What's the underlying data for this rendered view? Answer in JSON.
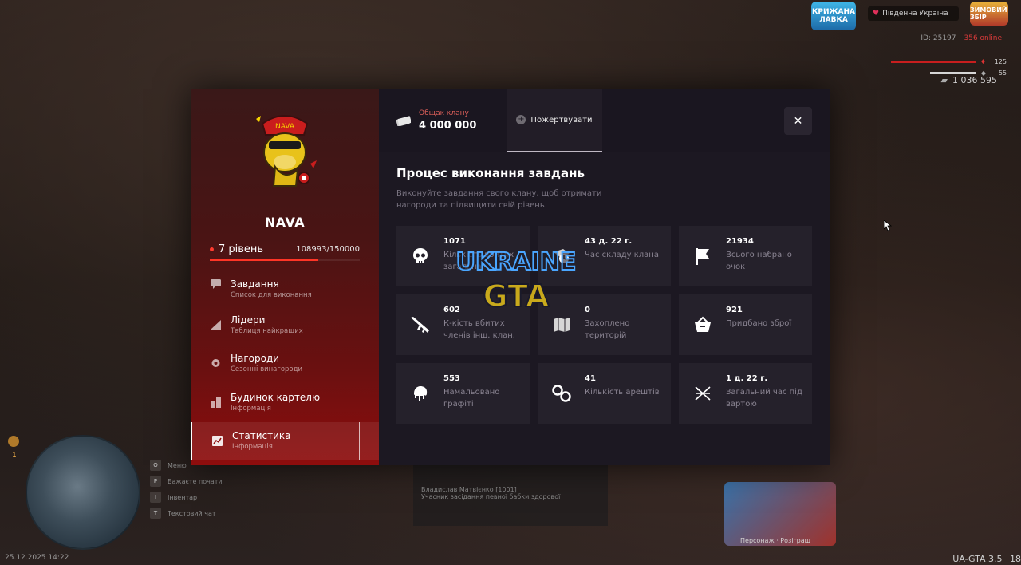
{
  "hud": {
    "logo_text": "КРИЖАНА ЛАВКА",
    "logo2_text": "ЗИМОВИЙ ЗБІР",
    "region": "Південна Україна",
    "player_id": "ID: 25197",
    "online": "356 online",
    "health": "125",
    "armor": "55",
    "money": "1 036 595",
    "datetime": "25.12.2025 14:22",
    "version": "UA-GTA 3.5",
    "fps": "18",
    "minimap_number": "1",
    "hints": [
      {
        "key": "O",
        "label": "Меню"
      },
      {
        "key": "P",
        "label": "Бажаєте почати"
      },
      {
        "key": "I",
        "label": "Інвентар"
      },
      {
        "key": "T",
        "label": "Текстовий чат"
      }
    ],
    "bg_panel": {
      "name": "Владислав Матвієнко [1001]",
      "desc": "Учасник засідання певної бабки здорової"
    },
    "promo_footer": "Персонаж · Розіграш"
  },
  "clan": {
    "name": "NAVA",
    "level_label": "7 рівень",
    "xp_text": "108993/150000",
    "xp_fraction": 0.726
  },
  "menu": [
    {
      "title": "Завдання",
      "subtitle": "Список для виконання"
    },
    {
      "title": "Лідери",
      "subtitle": "Таблиця найкращих"
    },
    {
      "title": "Нагороди",
      "subtitle": "Сезонні винагороди"
    },
    {
      "title": "Будинок картелю",
      "subtitle": "Інформація"
    },
    {
      "title": "Статистика",
      "subtitle": "Інформація"
    }
  ],
  "topbar": {
    "balance_label": "Общак клану",
    "balance_amount": "4 000 000",
    "donate_label": "Пожертвувати",
    "close_symbol": "✕"
  },
  "section": {
    "title": "Процес виконання завдань",
    "description": "Виконуйте завдання свого клану, щоб отримати нагороди та підвищити свій рівень"
  },
  "stats": [
    {
      "value": "1071",
      "label": "Кількість вбитих загальна",
      "icon": "skull-icon"
    },
    {
      "value": "43 д. 22 г.",
      "label": "Час складу клана",
      "icon": "clock-icon"
    },
    {
      "value": "21934",
      "label": "Всього набрано очок",
      "icon": "flag-icon"
    },
    {
      "value": "602",
      "label": "К-кість вбитих членів інш. клан.",
      "icon": "rifle-icon"
    },
    {
      "value": "0",
      "label": "Захоплено територій",
      "icon": "map-icon"
    },
    {
      "value": "921",
      "label": "Придбано зброї",
      "icon": "basket-icon"
    },
    {
      "value": "553",
      "label": "Намальовано графіті",
      "icon": "spray-icon"
    },
    {
      "value": "41",
      "label": "Кількість арештів",
      "icon": "handcuffs-icon"
    },
    {
      "value": "1 д. 22 г.",
      "label": "Загальний час під вартою",
      "icon": "fence-icon"
    }
  ],
  "watermark": {
    "line1": "UKRAINE",
    "line2": "GTA"
  }
}
